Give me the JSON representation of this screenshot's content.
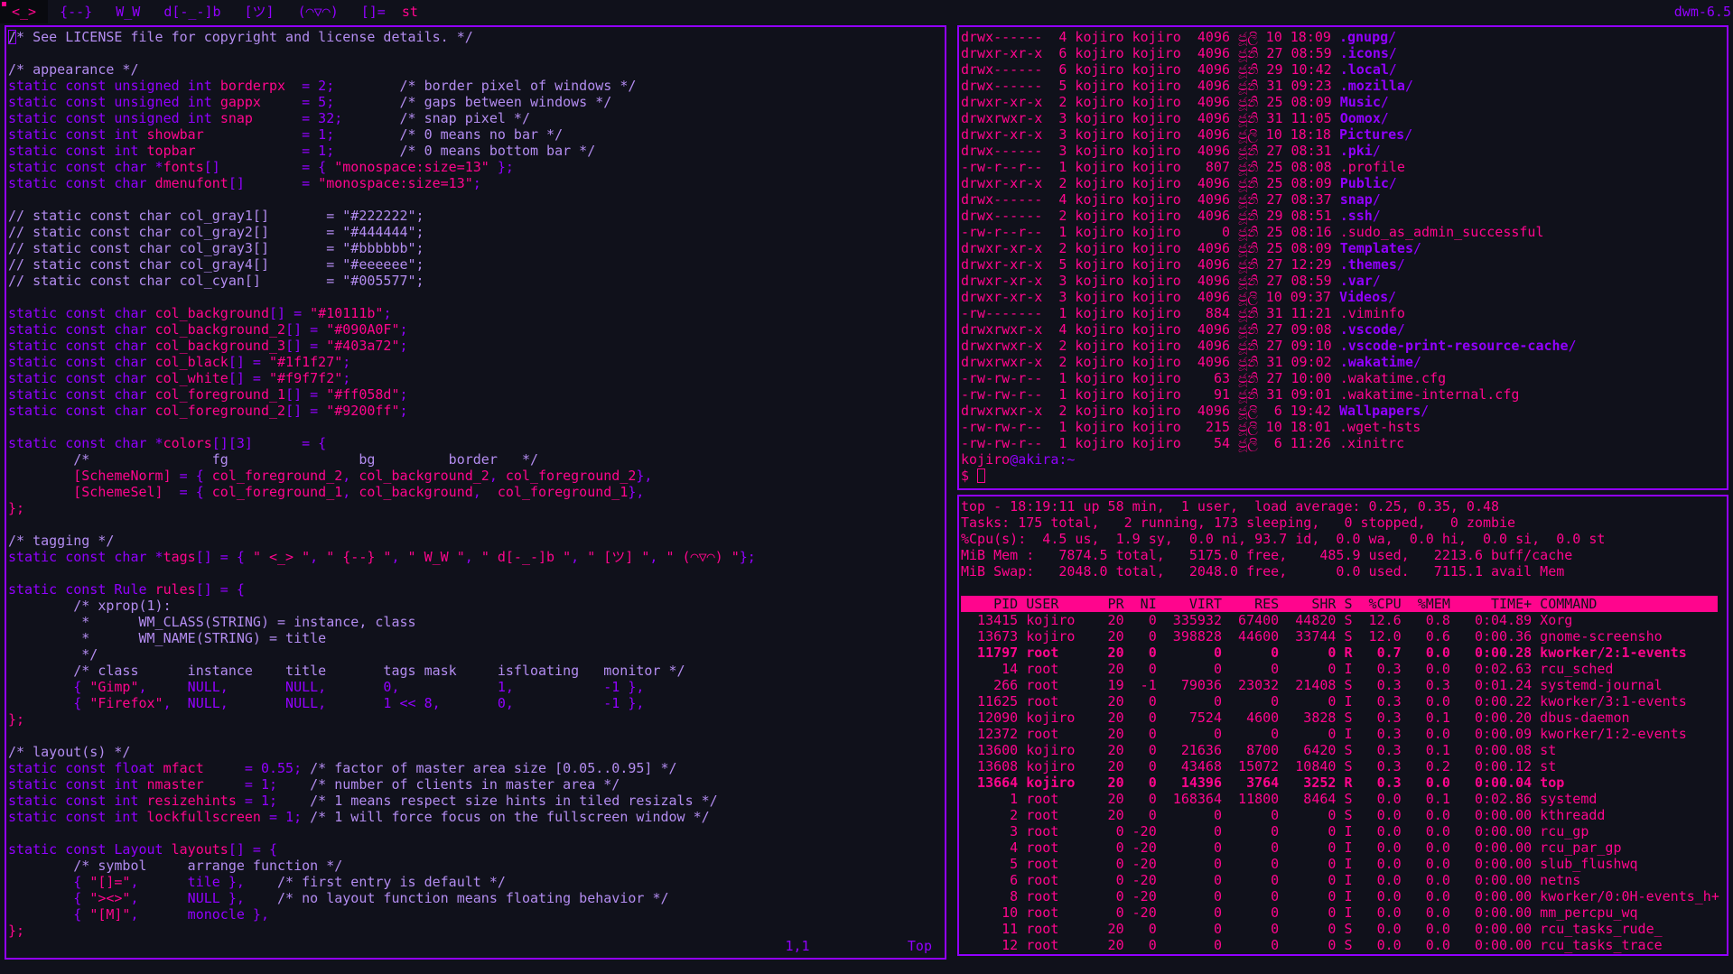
{
  "bar": {
    "tags": [
      "<_>",
      "{--}",
      "W_W",
      "d[-_-]b",
      "[ツ]",
      "(◠▽◠)"
    ],
    "selected_tag": 0,
    "layout_symbol": "[]=",
    "window_title": "st",
    "status": "dwm-6.5"
  },
  "colors": {
    "background": "#10111b",
    "background_2": "#090A0F",
    "background_3": "#403a72",
    "black": "#1f1f27",
    "white": "#f9f7f2",
    "foreground_1": "#ff058d",
    "foreground_2": "#9200ff"
  },
  "vim": {
    "lines": [
      "/* See LICENSE file for copyright and license details. */",
      "",
      "/* appearance */",
      "static const unsigned int borderpx  = 2;        /* border pixel of windows */",
      "static const unsigned int gappx     = 5;        /* gaps between windows */",
      "static const unsigned int snap      = 32;       /* snap pixel */",
      "static const int showbar            = 1;        /* 0 means no bar */",
      "static const int topbar             = 1;        /* 0 means bottom bar */",
      "static const char *fonts[]          = { \"monospace:size=13\" };",
      "static const char dmenufont[]       = \"monospace:size=13\";",
      "",
      "// static const char col_gray1[]       = \"#222222\";",
      "// static const char col_gray2[]       = \"#444444\";",
      "// static const char col_gray3[]       = \"#bbbbbb\";",
      "// static const char col_gray4[]       = \"#eeeeee\";",
      "// static const char col_cyan[]        = \"#005577\";",
      "",
      "static const char col_background[] = \"#10111b\";",
      "static const char col_background_2[] = \"#090A0F\";",
      "static const char col_background_3[] = \"#403a72\";",
      "static const char col_black[] = \"#1f1f27\";",
      "static const char col_white[] = \"#f9f7f2\";",
      "static const char col_foreground_1[] = \"#ff058d\";",
      "static const char col_foreground_2[] = \"#9200ff\";",
      "",
      "static const char *colors[][3]      = {",
      "        /*               fg                bg         border   */",
      "        [SchemeNorm] = { col_foreground_2, col_background_2, col_foreground_2},",
      "        [SchemeSel]  = { col_foreground_1, col_background,  col_foreground_1},",
      "};",
      "",
      "/* tagging */",
      "static const char *tags[] = { \" <_> \", \" {--} \", \" W_W \", \" d[-_-]b \", \" [ツ] \", \" (◠▽◠) \"};",
      "",
      "static const Rule rules[] = {",
      "        /* xprop(1):",
      "         *      WM_CLASS(STRING) = instance, class",
      "         *      WM_NAME(STRING) = title",
      "         */",
      "        /* class      instance    title       tags mask     isfloating   monitor */",
      "        { \"Gimp\",     NULL,       NULL,       0,            1,           -1 },",
      "        { \"Firefox\",  NULL,       NULL,       1 << 8,       0,           -1 },",
      "};",
      "",
      "/* layout(s) */",
      "static const float mfact     = 0.55; /* factor of master area size [0.05..0.95] */",
      "static const int nmaster     = 1;    /* number of clients in master area */",
      "static const int resizehints = 1;    /* 1 means respect size hints in tiled resizals */",
      "static const int lockfullscreen = 1; /* 1 will force focus on the fullscreen window */",
      "",
      "static const Layout layouts[] = {",
      "        /* symbol     arrange function */",
      "        { \"[]=\",      tile },    /* first entry is default */",
      "        { \"><>\",      NULL },    /* no layout function means floating behavior */",
      "        { \"[M]\",      monocle },",
      "};"
    ],
    "ruler_pos": "1,1",
    "ruler_scroll": "Top"
  },
  "ls": {
    "rows": [
      {
        "perm": "drwx------",
        "links": "4",
        "user": "kojiro",
        "group": "kojiro",
        "size": "4096",
        "mon": "ජූලි",
        "day": "10",
        "time": "18:09",
        "name": ".gnupg",
        "dir": true
      },
      {
        "perm": "drwxr-xr-x",
        "links": "6",
        "user": "kojiro",
        "group": "kojiro",
        "size": "4096",
        "mon": "ජූනි",
        "day": "27",
        "time": "08:59",
        "name": ".icons",
        "dir": true
      },
      {
        "perm": "drwx------",
        "links": "6",
        "user": "kojiro",
        "group": "kojiro",
        "size": "4096",
        "mon": "ජූනි",
        "day": "29",
        "time": "10:42",
        "name": ".local",
        "dir": true
      },
      {
        "perm": "drwx------",
        "links": "5",
        "user": "kojiro",
        "group": "kojiro",
        "size": "4096",
        "mon": "ජූනි",
        "day": "31",
        "time": "09:23",
        "name": ".mozilla",
        "dir": true
      },
      {
        "perm": "drwxr-xr-x",
        "links": "2",
        "user": "kojiro",
        "group": "kojiro",
        "size": "4096",
        "mon": "ජූනි",
        "day": "25",
        "time": "08:09",
        "name": "Music",
        "dir": true
      },
      {
        "perm": "drwxrwxr-x",
        "links": "3",
        "user": "kojiro",
        "group": "kojiro",
        "size": "4096",
        "mon": "ජූනි",
        "day": "31",
        "time": "11:05",
        "name": "Oomox",
        "dir": true
      },
      {
        "perm": "drwxr-xr-x",
        "links": "3",
        "user": "kojiro",
        "group": "kojiro",
        "size": "4096",
        "mon": "ජූලි",
        "day": "10",
        "time": "18:18",
        "name": "Pictures",
        "dir": true
      },
      {
        "perm": "drwx------",
        "links": "3",
        "user": "kojiro",
        "group": "kojiro",
        "size": "4096",
        "mon": "ජූනි",
        "day": "27",
        "time": "08:31",
        "name": ".pki",
        "dir": true
      },
      {
        "perm": "-rw-r--r--",
        "links": "1",
        "user": "kojiro",
        "group": "kojiro",
        "size": "807",
        "mon": "ජූනි",
        "day": "25",
        "time": "08:08",
        "name": ".profile",
        "dir": false
      },
      {
        "perm": "drwxr-xr-x",
        "links": "2",
        "user": "kojiro",
        "group": "kojiro",
        "size": "4096",
        "mon": "ජූනි",
        "day": "25",
        "time": "08:09",
        "name": "Public",
        "dir": true
      },
      {
        "perm": "drwx------",
        "links": "4",
        "user": "kojiro",
        "group": "kojiro",
        "size": "4096",
        "mon": "ජූනි",
        "day": "27",
        "time": "08:37",
        "name": "snap",
        "dir": true
      },
      {
        "perm": "drwx------",
        "links": "2",
        "user": "kojiro",
        "group": "kojiro",
        "size": "4096",
        "mon": "ජූනි",
        "day": "29",
        "time": "08:51",
        "name": ".ssh",
        "dir": true
      },
      {
        "perm": "-rw-r--r--",
        "links": "1",
        "user": "kojiro",
        "group": "kojiro",
        "size": "0",
        "mon": "ජූනි",
        "day": "25",
        "time": "08:16",
        "name": ".sudo_as_admin_successful",
        "dir": false
      },
      {
        "perm": "drwxr-xr-x",
        "links": "2",
        "user": "kojiro",
        "group": "kojiro",
        "size": "4096",
        "mon": "ජූනි",
        "day": "25",
        "time": "08:09",
        "name": "Templates",
        "dir": true
      },
      {
        "perm": "drwxr-xr-x",
        "links": "5",
        "user": "kojiro",
        "group": "kojiro",
        "size": "4096",
        "mon": "ජූනි",
        "day": "27",
        "time": "12:29",
        "name": ".themes",
        "dir": true
      },
      {
        "perm": "drwxr-xr-x",
        "links": "3",
        "user": "kojiro",
        "group": "kojiro",
        "size": "4096",
        "mon": "ජූනි",
        "day": "27",
        "time": "08:59",
        "name": ".var",
        "dir": true
      },
      {
        "perm": "drwxr-xr-x",
        "links": "3",
        "user": "kojiro",
        "group": "kojiro",
        "size": "4096",
        "mon": "ජූලි",
        "day": "10",
        "time": "09:37",
        "name": "Videos",
        "dir": true
      },
      {
        "perm": "-rw-------",
        "links": "1",
        "user": "kojiro",
        "group": "kojiro",
        "size": "884",
        "mon": "ජූනි",
        "day": "31",
        "time": "11:21",
        "name": ".viminfo",
        "dir": false
      },
      {
        "perm": "drwxrwxr-x",
        "links": "4",
        "user": "kojiro",
        "group": "kojiro",
        "size": "4096",
        "mon": "ජූනි",
        "day": "27",
        "time": "09:08",
        "name": ".vscode",
        "dir": true
      },
      {
        "perm": "drwxrwxr-x",
        "links": "2",
        "user": "kojiro",
        "group": "kojiro",
        "size": "4096",
        "mon": "ජූනි",
        "day": "27",
        "time": "09:10",
        "name": ".vscode-print-resource-cache",
        "dir": true
      },
      {
        "perm": "drwxrwxr-x",
        "links": "2",
        "user": "kojiro",
        "group": "kojiro",
        "size": "4096",
        "mon": "ජූනි",
        "day": "31",
        "time": "09:02",
        "name": ".wakatime",
        "dir": true
      },
      {
        "perm": "-rw-rw-r--",
        "links": "1",
        "user": "kojiro",
        "group": "kojiro",
        "size": "63",
        "mon": "ජූනි",
        "day": "27",
        "time": "10:00",
        "name": ".wakatime.cfg",
        "dir": false
      },
      {
        "perm": "-rw-rw-r--",
        "links": "1",
        "user": "kojiro",
        "group": "kojiro",
        "size": "91",
        "mon": "ජූනි",
        "day": "31",
        "time": "09:01",
        "name": ".wakatime-internal.cfg",
        "dir": false
      },
      {
        "perm": "drwxrwxr-x",
        "links": "2",
        "user": "kojiro",
        "group": "kojiro",
        "size": "4096",
        "mon": "ජූලි",
        "day": "6",
        "time": "19:42",
        "name": "Wallpapers",
        "dir": true
      },
      {
        "perm": "-rw-rw-r--",
        "links": "1",
        "user": "kojiro",
        "group": "kojiro",
        "size": "215",
        "mon": "ජූලි",
        "day": "10",
        "time": "18:01",
        "name": ".wget-hsts",
        "dir": false
      },
      {
        "perm": "-rw-rw-r--",
        "links": "1",
        "user": "kojiro",
        "group": "kojiro",
        "size": "54",
        "mon": "ජූලි",
        "day": "6",
        "time": "11:26",
        "name": ".xinitrc",
        "dir": false
      }
    ],
    "prompt_user": "kojiro",
    "prompt_at": "@",
    "prompt_host": "akira",
    "prompt_path": ":~",
    "prompt_symbol": "$ "
  },
  "top": {
    "summary": [
      "top - 18:19:11 up 58 min,  1 user,  load average: 0.25, 0.35, 0.48",
      "Tasks: 175 total,   2 running, 173 sleeping,   0 stopped,   0 zombie",
      "%Cpu(s):  4.5 us,  1.9 sy,  0.0 ni, 93.7 id,  0.0 wa,  0.0 hi,  0.0 si,  0.0 st",
      "MiB Mem :   7874.5 total,   5175.0 free,    485.9 used,   2213.6 buff/cache",
      "MiB Swap:   2048.0 total,   2048.0 free,      0.0 used.   7115.1 avail Mem"
    ],
    "header": "    PID USER      PR  NI    VIRT    RES    SHR S  %CPU  %MEM     TIME+ COMMAND",
    "procs": [
      {
        "t": "  13415 kojiro    20   0  335932  67400  44820 S  12.6   0.8   0:04.89 Xorg",
        "b": false
      },
      {
        "t": "  13673 kojiro    20   0  398828  44600  33744 S  12.0   0.6   0:00.36 gnome-screensho",
        "b": false
      },
      {
        "t": "  11797 root      20   0       0      0      0 R   0.7   0.0   0:00.28 kworker/2:1-events",
        "b": true
      },
      {
        "t": "     14 root      20   0       0      0      0 I   0.3   0.0   0:02.63 rcu_sched",
        "b": false
      },
      {
        "t": "    266 root      19  -1   79036  23032  21408 S   0.3   0.3   0:01.24 systemd-journal",
        "b": false
      },
      {
        "t": "  11625 root      20   0       0      0      0 I   0.3   0.0   0:00.22 kworker/3:1-events",
        "b": false
      },
      {
        "t": "  12090 kojiro    20   0    7524   4600   3828 S   0.3   0.1   0:00.20 dbus-daemon",
        "b": false
      },
      {
        "t": "  12372 root      20   0       0      0      0 I   0.3   0.0   0:00.09 kworker/1:2-events",
        "b": false
      },
      {
        "t": "  13600 kojiro    20   0   21636   8700   6420 S   0.3   0.1   0:00.08 st",
        "b": false
      },
      {
        "t": "  13608 kojiro    20   0   43468  15072  10840 S   0.3   0.2   0:00.12 st",
        "b": false
      },
      {
        "t": "  13664 kojiro    20   0   14396   3764   3252 R   0.3   0.0   0:00.04 top",
        "b": true
      },
      {
        "t": "      1 root      20   0  168364  11800   8464 S   0.0   0.1   0:02.86 systemd",
        "b": false
      },
      {
        "t": "      2 root      20   0       0      0      0 S   0.0   0.0   0:00.00 kthreadd",
        "b": false
      },
      {
        "t": "      3 root       0 -20       0      0      0 I   0.0   0.0   0:00.00 rcu_gp",
        "b": false
      },
      {
        "t": "      4 root       0 -20       0      0      0 I   0.0   0.0   0:00.00 rcu_par_gp",
        "b": false
      },
      {
        "t": "      5 root       0 -20       0      0      0 I   0.0   0.0   0:00.00 slub_flushwq",
        "b": false
      },
      {
        "t": "      6 root       0 -20       0      0      0 I   0.0   0.0   0:00.00 netns",
        "b": false
      },
      {
        "t": "      8 root       0 -20       0      0      0 I   0.0   0.0   0:00.00 kworker/0:0H-events_h+",
        "b": false
      },
      {
        "t": "     10 root       0 -20       0      0      0 I   0.0   0.0   0:00.00 mm_percpu_wq",
        "b": false
      },
      {
        "t": "     11 root      20   0       0      0      0 S   0.0   0.0   0:00.00 rcu_tasks_rude_",
        "b": false
      },
      {
        "t": "     12 root      20   0       0      0      0 S   0.0   0.0   0:00.00 rcu_tasks_trace",
        "b": false
      }
    ]
  }
}
